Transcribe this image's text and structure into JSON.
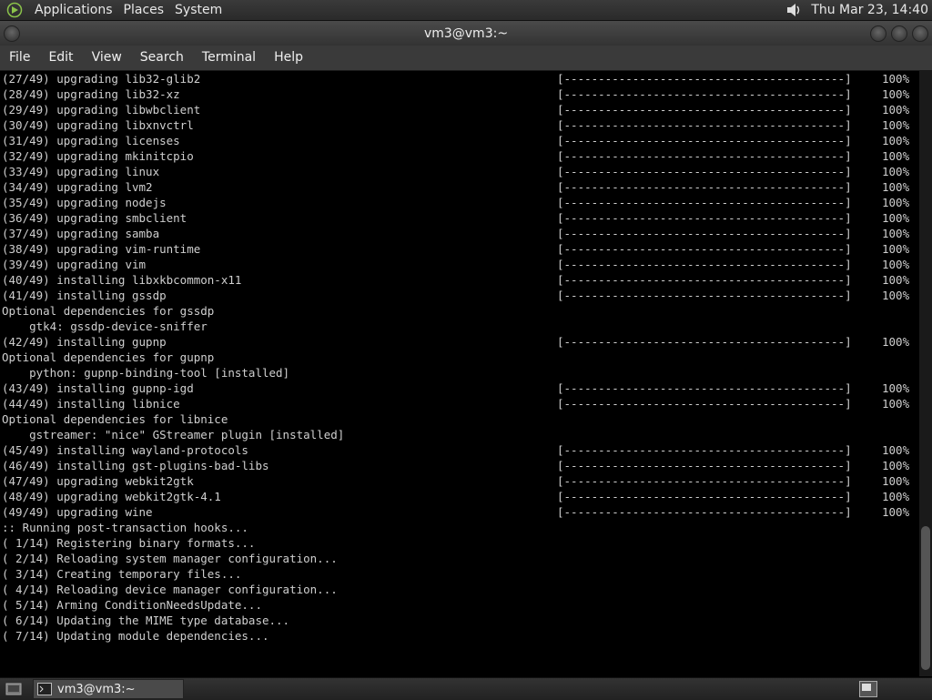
{
  "top_panel": {
    "menus": [
      "Applications",
      "Places",
      "System"
    ],
    "clock": "Thu Mar 23, 14:40"
  },
  "window": {
    "title": "vm3@vm3:~",
    "menus": [
      "File",
      "Edit",
      "View",
      "Search",
      "Terminal",
      "Help"
    ]
  },
  "terminal": {
    "progress_bar": "[-----------------------------------------]",
    "lines": [
      {
        "text": "(27/49) upgrading lib32-glib2",
        "progress": "100%"
      },
      {
        "text": "(28/49) upgrading lib32-xz",
        "progress": "100%"
      },
      {
        "text": "(29/49) upgrading libwbclient",
        "progress": "100%"
      },
      {
        "text": "(30/49) upgrading libxnvctrl",
        "progress": "100%"
      },
      {
        "text": "(31/49) upgrading licenses",
        "progress": "100%"
      },
      {
        "text": "(32/49) upgrading mkinitcpio",
        "progress": "100%"
      },
      {
        "text": "(33/49) upgrading linux",
        "progress": "100%"
      },
      {
        "text": "(34/49) upgrading lvm2",
        "progress": "100%"
      },
      {
        "text": "(35/49) upgrading nodejs",
        "progress": "100%"
      },
      {
        "text": "(36/49) upgrading smbclient",
        "progress": "100%"
      },
      {
        "text": "(37/49) upgrading samba",
        "progress": "100%"
      },
      {
        "text": "(38/49) upgrading vim-runtime",
        "progress": "100%"
      },
      {
        "text": "(39/49) upgrading vim",
        "progress": "100%"
      },
      {
        "text": "(40/49) installing libxkbcommon-x11",
        "progress": "100%"
      },
      {
        "text": "(41/49) installing gssdp",
        "progress": "100%"
      },
      {
        "text": "Optional dependencies for gssdp"
      },
      {
        "text": "    gtk4: gssdp-device-sniffer"
      },
      {
        "text": "(42/49) installing gupnp",
        "progress": "100%"
      },
      {
        "text": "Optional dependencies for gupnp"
      },
      {
        "text": "    python: gupnp-binding-tool [installed]"
      },
      {
        "text": "(43/49) installing gupnp-igd",
        "progress": "100%"
      },
      {
        "text": "(44/49) installing libnice",
        "progress": "100%"
      },
      {
        "text": "Optional dependencies for libnice"
      },
      {
        "text": "    gstreamer: \"nice\" GStreamer plugin [installed]"
      },
      {
        "text": "(45/49) installing wayland-protocols",
        "progress": "100%"
      },
      {
        "text": "(46/49) installing gst-plugins-bad-libs",
        "progress": "100%"
      },
      {
        "text": "(47/49) upgrading webkit2gtk",
        "progress": "100%"
      },
      {
        "text": "(48/49) upgrading webkit2gtk-4.1",
        "progress": "100%"
      },
      {
        "text": "(49/49) upgrading wine",
        "progress": "100%"
      },
      {
        "text": ":: Running post-transaction hooks..."
      },
      {
        "text": "( 1/14) Registering binary formats..."
      },
      {
        "text": "( 2/14) Reloading system manager configuration..."
      },
      {
        "text": "( 3/14) Creating temporary files..."
      },
      {
        "text": "( 4/14) Reloading device manager configuration..."
      },
      {
        "text": "( 5/14) Arming ConditionNeedsUpdate..."
      },
      {
        "text": "( 6/14) Updating the MIME type database..."
      },
      {
        "text": "( 7/14) Updating module dependencies..."
      }
    ]
  },
  "taskbar": {
    "task_label": "vm3@vm3:~"
  }
}
